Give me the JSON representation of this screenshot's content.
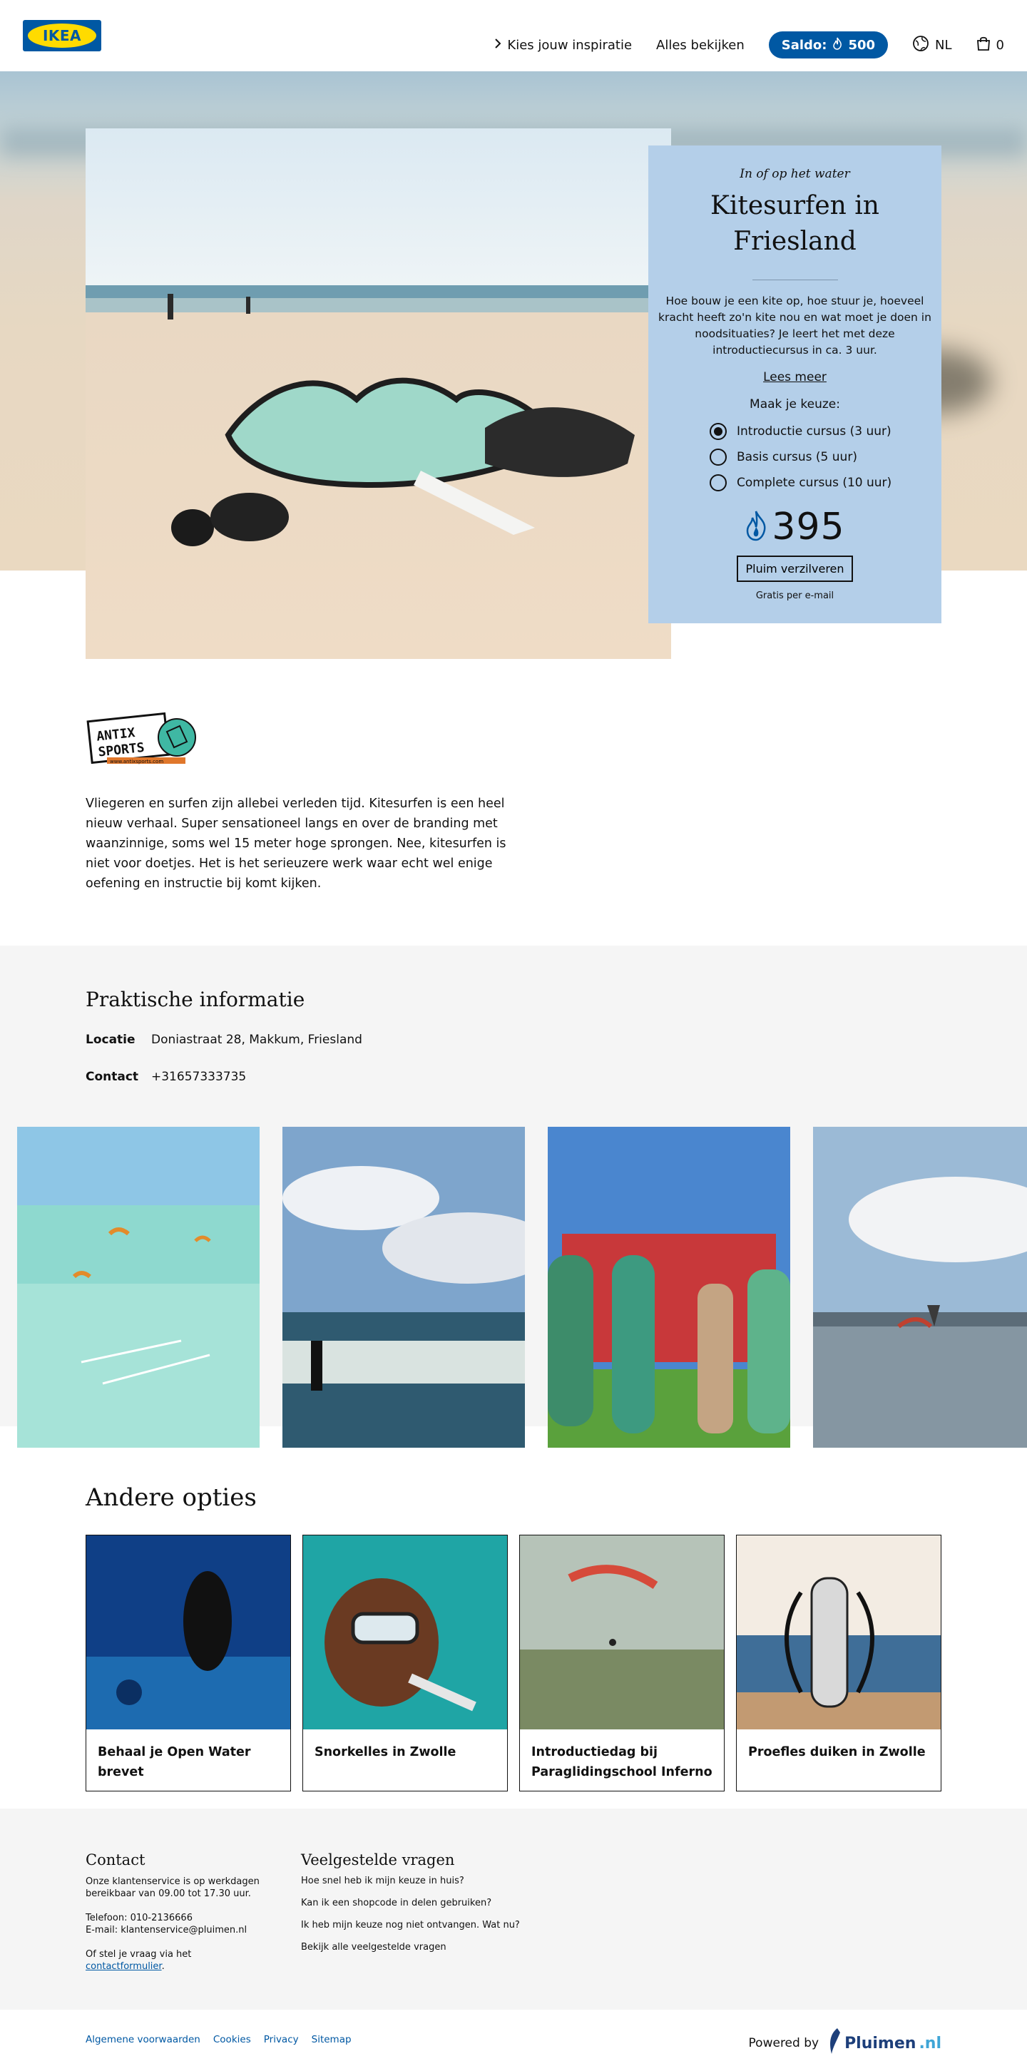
{
  "header": {
    "logo_text": "IKEA",
    "nav": {
      "inspiration": "Kies jouw inspiratie",
      "all": "Alles bekijken",
      "saldo_label": "Saldo:",
      "saldo_value": "500",
      "language": "NL",
      "cart_count": "0"
    }
  },
  "hero": {
    "kicker": "In of op het water",
    "title": "Kitesurfen in Friesland",
    "description": "Hoe bouw je een kite op, hoe stuur je, hoeveel kracht heeft zo'n kite nou en wat moet je doen in noodsituaties? Je leert het met deze introductiecursus in ca. 3 uur.",
    "read_more": "Lees meer",
    "choose_label": "Maak je keuze:",
    "options": [
      {
        "label": "Introductie cursus (3 uur)",
        "selected": true
      },
      {
        "label": "Basis cursus (5 uur)",
        "selected": false
      },
      {
        "label": "Complete cursus (10 uur)",
        "selected": false
      }
    ],
    "price": "395",
    "redeem_button": "Pluim verzilveren",
    "delivery_note": "Gratis per e-mail"
  },
  "partner": {
    "logo_line1": "ANTIX",
    "logo_line2": "SPORTS",
    "logo_url_text": "www.antixsports.com"
  },
  "intro_text": "Vliegeren en surfen zijn allebei verleden tijd. Kitesurfen is een heel nieuw verhaal. Super sensationeel langs en over de branding met waanzinnige, soms wel 15 meter hoge sprongen. Nee, kitesurfen is niet voor doetjes. Het is het serieuzere werk waar echt wel enige oefening en instructie bij komt kijken.",
  "info": {
    "title": "Praktische informatie",
    "location_label": "Locatie",
    "location_value": "Doniastraat 28, Makkum, Friesland",
    "contact_label": "Contact",
    "contact_value": "+31657333735"
  },
  "other": {
    "title": "Andere opties",
    "cards": [
      {
        "title": "Behaal je Open Water brevet"
      },
      {
        "title": "Snorkelles in Zwolle"
      },
      {
        "title": "Introductiedag bij Paraglidingschool Inferno"
      },
      {
        "title": "Proefles duiken in Zwolle"
      }
    ]
  },
  "footer": {
    "contact_title": "Contact",
    "contact_hours": "Onze klantenservice is op werkdagen bereikbaar van 09.00 tot 17.30 uur.",
    "phone": "Telefoon: 010-2136666",
    "email": "E-mail: klantenservice@pluimen.nl",
    "form_prefix": "Of stel je vraag via het ",
    "form_link": "contactformulier",
    "form_suffix": ".",
    "faq_title": "Veelgestelde vragen",
    "faq": [
      "Hoe snel heb ik mijn keuze in huis?",
      "Kan ik een shopcode in delen gebruiken?",
      "Ik heb mijn keuze nog niet ontvangen. Wat nu?",
      "Bekijk alle veelgestelde vragen"
    ]
  },
  "bottom": {
    "links": [
      "Algemene voorwaarden",
      "Cookies",
      "Privacy",
      "Sitemap"
    ],
    "powered_by": "Powered by",
    "brand": "Pluimen",
    "brand_suffix": ".nl"
  },
  "colors": {
    "ikea_blue": "#0058a3",
    "ikea_yellow": "#ffdb00",
    "card_blue": "#b4cfe9",
    "panel_grey": "#f5f5f5"
  }
}
